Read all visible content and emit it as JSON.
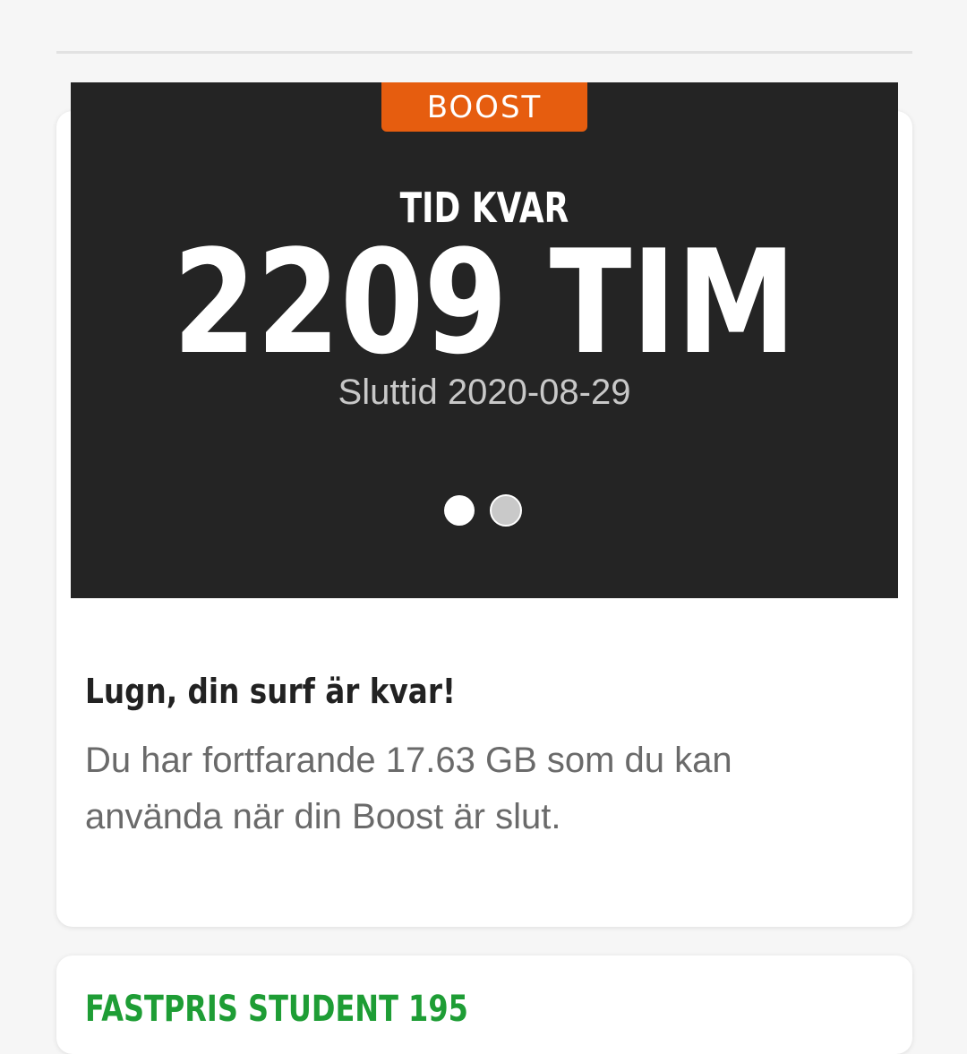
{
  "boost_card": {
    "tag_label": "BOOST",
    "time_label": "TID KVAR",
    "time_value": "2209 TIM",
    "end_time": "Sluttid 2020-08-29",
    "pager": {
      "count": 2,
      "active_index": 0
    },
    "message_title": "Lugn, din surf är kvar!",
    "message_body": "Du har fortfarande 17.63 GB som du kan använda när din Boost är slut."
  },
  "plan_card": {
    "title": "FASTPRIS STUDENT 195"
  },
  "colors": {
    "page_background": "#f6f6f6",
    "boost_panel": "#242424",
    "boost_tag": "#e65d0f",
    "plan_title": "#1e9d35"
  }
}
